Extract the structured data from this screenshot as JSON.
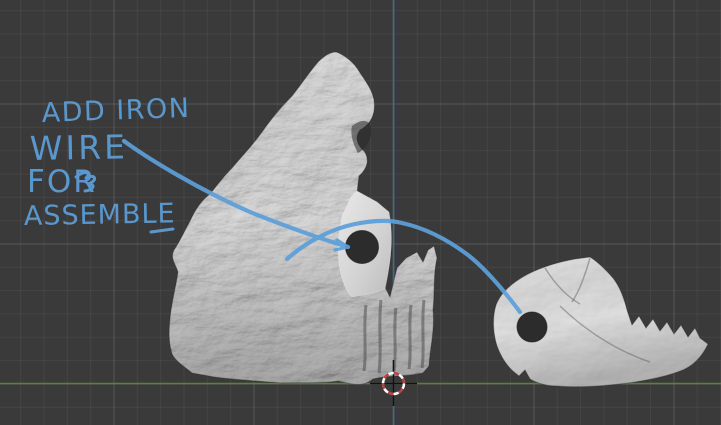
{
  "viewport": {
    "background_color": "#3a3a3a",
    "grid_minor_color": "#464646",
    "grid_major_color": "#4d4d4d",
    "axis_vertical_color": "#47688e",
    "axis_horizontal_color": "#5e7c45"
  },
  "annotation": {
    "ink_color": "#5c9fd9",
    "lines": [
      "ADD IRON",
      "WIRE",
      "FOR",
      "ASSEMBLE"
    ]
  },
  "cursor_3d": {
    "ring_red_color": "#c24044",
    "ring_white_color": "#ffffff",
    "crosshair_color": "#111111"
  },
  "icons": {
    "cursor_3d": "dashed-circle-crosshair"
  }
}
